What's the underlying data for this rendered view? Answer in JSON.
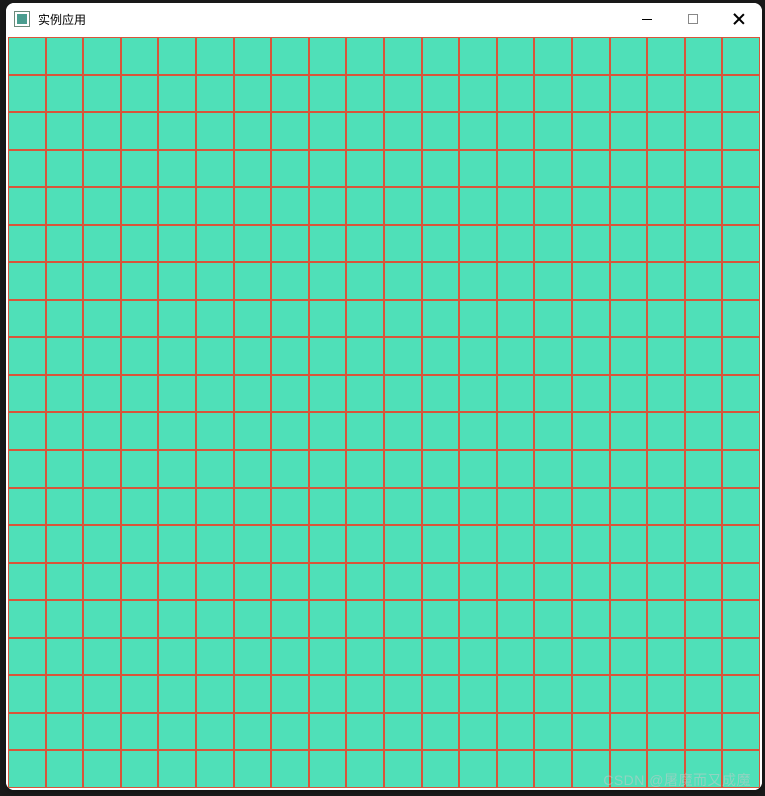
{
  "window": {
    "title": "实例应用"
  },
  "grid": {
    "rows": 20,
    "cols": 20,
    "cell_fill": "#4fe0b8",
    "border_color": "#d8553a"
  },
  "watermark": {
    "text": "CSDN @屠魔而又成魔"
  }
}
